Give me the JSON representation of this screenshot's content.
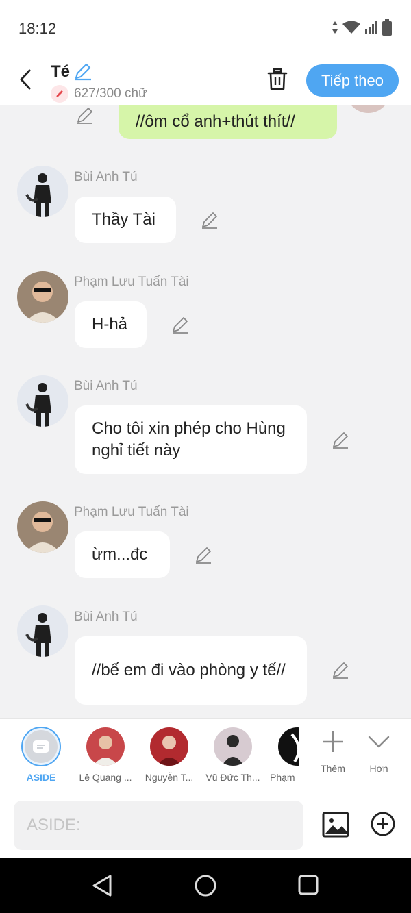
{
  "status_bar": {
    "time": "18:12"
  },
  "header": {
    "title": "Té",
    "counter": "627/300 chữ",
    "next_label": "Tiếp theo"
  },
  "messages": [
    {
      "type": "right",
      "text": "//ôm cổ anh+thút thít//"
    },
    {
      "sender": "Bùi Anh Tú",
      "text": "Thầy Tài"
    },
    {
      "sender": "Phạm Lưu Tuấn Tài",
      "text": "H-hả"
    },
    {
      "sender": "Bùi Anh Tú",
      "text": "Cho tôi xin phép cho Hùng nghỉ tiết này"
    },
    {
      "sender": "Phạm Lưu Tuấn Tài",
      "text": "ừm...đc"
    },
    {
      "sender": "Bùi Anh Tú",
      "text": "//bế em đi vào phòng y tế//"
    }
  ],
  "characters": [
    {
      "label": "ASIDE"
    },
    {
      "label": "Lê Quang ..."
    },
    {
      "label": "Nguyễn T..."
    },
    {
      "label": "Vũ Đức Th..."
    },
    {
      "label": "Phạm"
    }
  ],
  "actions": {
    "add_label": "Thêm",
    "more_label": "Hơn"
  },
  "input": {
    "placeholder": "ASIDE:"
  },
  "colors": {
    "accent": "#4fa6f2",
    "bubble_green": "#d6f5a9",
    "background": "#f2f2f3"
  }
}
